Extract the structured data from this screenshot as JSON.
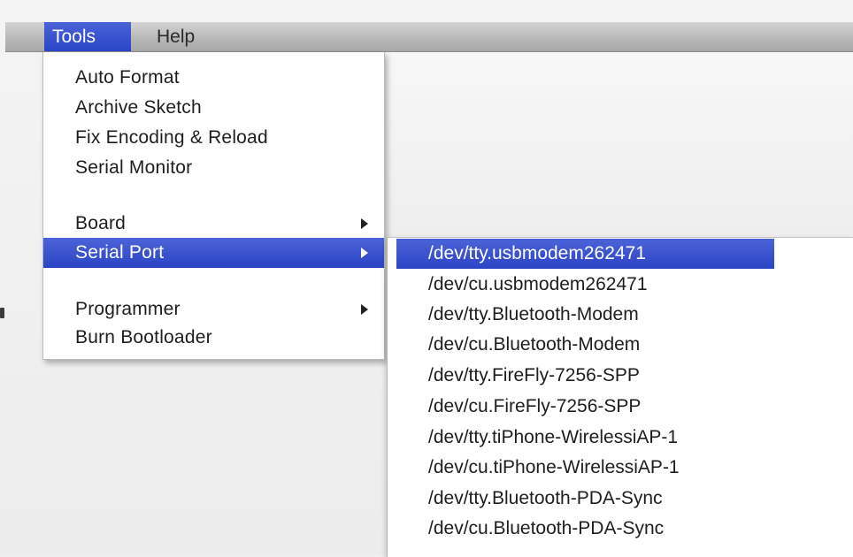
{
  "menubar": {
    "items": [
      {
        "label": "Tools"
      },
      {
        "label": "Help"
      }
    ]
  },
  "tools_menu": {
    "items": [
      {
        "label": "Auto Format"
      },
      {
        "label": "Archive Sketch"
      },
      {
        "label": "Fix Encoding & Reload"
      },
      {
        "label": "Serial Monitor"
      },
      {
        "label": "Board"
      },
      {
        "label": "Serial Port"
      },
      {
        "label": "Programmer"
      },
      {
        "label": "Burn Bootloader"
      }
    ]
  },
  "serial_port_menu": {
    "items": [
      {
        "label": "/dev/tty.usbmodem262471"
      },
      {
        "label": "/dev/cu.usbmodem262471"
      },
      {
        "label": "/dev/tty.Bluetooth-Modem"
      },
      {
        "label": "/dev/cu.Bluetooth-Modem"
      },
      {
        "label": "/dev/tty.FireFly-7256-SPP"
      },
      {
        "label": "/dev/cu.FireFly-7256-SPP"
      },
      {
        "label": "/dev/tty.tiPhone-WirelessiAP-1"
      },
      {
        "label": "/dev/cu.tiPhone-WirelessiAP-1"
      },
      {
        "label": "/dev/tty.Bluetooth-PDA-Sync"
      },
      {
        "label": "/dev/cu.Bluetooth-PDA-Sync"
      }
    ]
  },
  "icons": {
    "submenu_arrow": "chevron-right-icon"
  },
  "colors": {
    "highlight": "#2b44c4",
    "menu_background": "#ffffff",
    "menubar_background": "#b8b8b8"
  }
}
